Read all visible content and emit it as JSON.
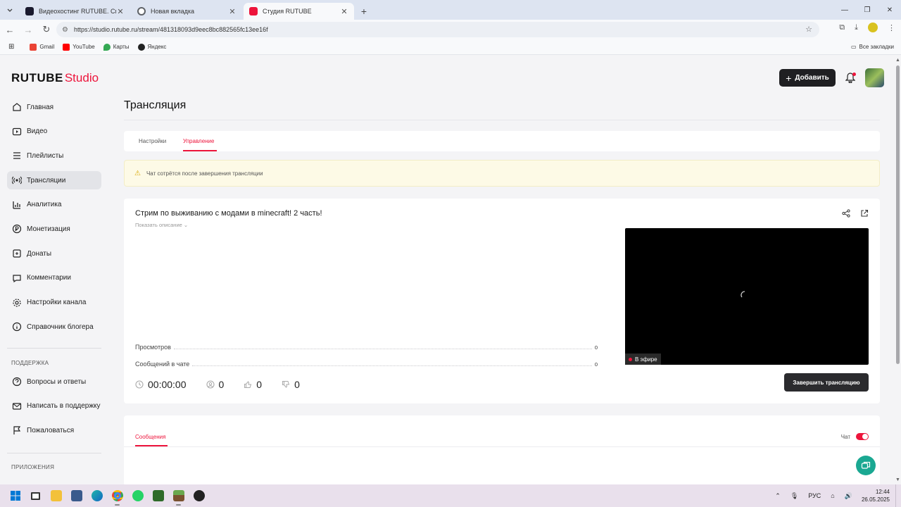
{
  "browser": {
    "tabs": [
      {
        "title": "Видеохостинг RUTUBE. Смотр",
        "favicon_color": "#1a1a2e",
        "active": false
      },
      {
        "title": "Новая вкладка",
        "favicon_color": "#5f6368",
        "active": false
      },
      {
        "title": "Студия RUTUBE",
        "favicon_color": "#ed143b",
        "active": true
      }
    ],
    "url": "https://studio.rutube.ru/stream/481318093d9eec8bc882565fc13ee16f",
    "bookmarks": [
      "Gmail",
      "YouTube",
      "Карты",
      "Яндекс"
    ],
    "all_bookmarks": "Все закладки"
  },
  "logo": {
    "brand": "RUTUBE",
    "product": "Studio"
  },
  "sidebar": {
    "items": [
      {
        "label": "Главная",
        "icon": "home-icon"
      },
      {
        "label": "Видео",
        "icon": "video-icon"
      },
      {
        "label": "Плейлисты",
        "icon": "playlist-icon"
      },
      {
        "label": "Трансляции",
        "icon": "broadcast-icon",
        "active": true
      },
      {
        "label": "Аналитика",
        "icon": "analytics-icon"
      },
      {
        "label": "Монетизация",
        "icon": "monetization-icon"
      },
      {
        "label": "Донаты",
        "icon": "donation-icon"
      },
      {
        "label": "Комментарии",
        "icon": "comments-icon"
      },
      {
        "label": "Настройки канала",
        "icon": "gear-icon"
      },
      {
        "label": "Справочник блогера",
        "icon": "handbook-icon"
      }
    ],
    "support_heading": "ПОДДЕРЖКА",
    "support_items": [
      {
        "label": "Вопросы и ответы",
        "icon": "question-icon"
      },
      {
        "label": "Написать в поддержку",
        "icon": "mail-icon"
      },
      {
        "label": "Пожаловаться",
        "icon": "flag-icon"
      }
    ],
    "apps_heading": "ПРИЛОЖЕНИЯ"
  },
  "header": {
    "add_label": "Добавить"
  },
  "main": {
    "title": "Трансляция",
    "tabs": [
      "Настройки",
      "Управление"
    ],
    "active_tab": "Управление",
    "warning": "Чат сотрётся после завершения трансляции",
    "stream": {
      "title": "Стрим по выживанию с модами в minecraft! 2 часть!",
      "show_description": "Показать описание",
      "stats": [
        {
          "label": "Просмотров",
          "value": "0"
        },
        {
          "label": "Сообщений в чате",
          "value": "0"
        }
      ],
      "live_badge": "В эфире",
      "timer": "00:00:00",
      "viewers": "0",
      "likes": "0",
      "dislikes": "0",
      "end_button": "Завершить трансляцию"
    },
    "messages": {
      "tab": "Сообщения",
      "chat_label": "Чат",
      "chat_enabled": true
    }
  },
  "taskbar": {
    "lang": "РУС",
    "time": "12:44",
    "date": "26.05.2025"
  },
  "colors": {
    "accent": "#ed143b",
    "dark_button": "#1f1f22",
    "fab": "#1aa892"
  }
}
